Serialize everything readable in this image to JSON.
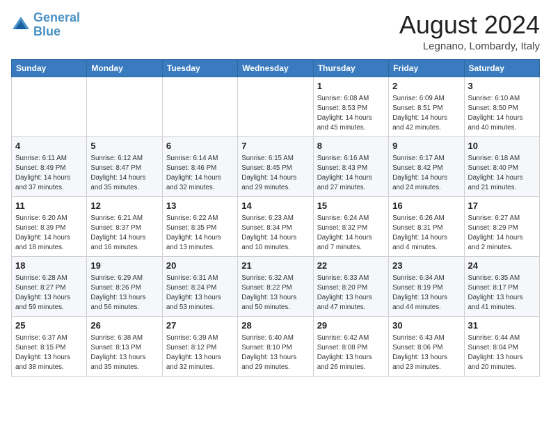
{
  "header": {
    "logo_line1": "General",
    "logo_line2": "Blue",
    "month_title": "August 2024",
    "location": "Legnano, Lombardy, Italy"
  },
  "weekdays": [
    "Sunday",
    "Monday",
    "Tuesday",
    "Wednesday",
    "Thursday",
    "Friday",
    "Saturday"
  ],
  "weeks": [
    [
      {
        "day": "",
        "info": ""
      },
      {
        "day": "",
        "info": ""
      },
      {
        "day": "",
        "info": ""
      },
      {
        "day": "",
        "info": ""
      },
      {
        "day": "1",
        "info": "Sunrise: 6:08 AM\nSunset: 8:53 PM\nDaylight: 14 hours\nand 45 minutes."
      },
      {
        "day": "2",
        "info": "Sunrise: 6:09 AM\nSunset: 8:51 PM\nDaylight: 14 hours\nand 42 minutes."
      },
      {
        "day": "3",
        "info": "Sunrise: 6:10 AM\nSunset: 8:50 PM\nDaylight: 14 hours\nand 40 minutes."
      }
    ],
    [
      {
        "day": "4",
        "info": "Sunrise: 6:11 AM\nSunset: 8:49 PM\nDaylight: 14 hours\nand 37 minutes."
      },
      {
        "day": "5",
        "info": "Sunrise: 6:12 AM\nSunset: 8:47 PM\nDaylight: 14 hours\nand 35 minutes."
      },
      {
        "day": "6",
        "info": "Sunrise: 6:14 AM\nSunset: 8:46 PM\nDaylight: 14 hours\nand 32 minutes."
      },
      {
        "day": "7",
        "info": "Sunrise: 6:15 AM\nSunset: 8:45 PM\nDaylight: 14 hours\nand 29 minutes."
      },
      {
        "day": "8",
        "info": "Sunrise: 6:16 AM\nSunset: 8:43 PM\nDaylight: 14 hours\nand 27 minutes."
      },
      {
        "day": "9",
        "info": "Sunrise: 6:17 AM\nSunset: 8:42 PM\nDaylight: 14 hours\nand 24 minutes."
      },
      {
        "day": "10",
        "info": "Sunrise: 6:18 AM\nSunset: 8:40 PM\nDaylight: 14 hours\nand 21 minutes."
      }
    ],
    [
      {
        "day": "11",
        "info": "Sunrise: 6:20 AM\nSunset: 8:39 PM\nDaylight: 14 hours\nand 18 minutes."
      },
      {
        "day": "12",
        "info": "Sunrise: 6:21 AM\nSunset: 8:37 PM\nDaylight: 14 hours\nand 16 minutes."
      },
      {
        "day": "13",
        "info": "Sunrise: 6:22 AM\nSunset: 8:35 PM\nDaylight: 14 hours\nand 13 minutes."
      },
      {
        "day": "14",
        "info": "Sunrise: 6:23 AM\nSunset: 8:34 PM\nDaylight: 14 hours\nand 10 minutes."
      },
      {
        "day": "15",
        "info": "Sunrise: 6:24 AM\nSunset: 8:32 PM\nDaylight: 14 hours\nand 7 minutes."
      },
      {
        "day": "16",
        "info": "Sunrise: 6:26 AM\nSunset: 8:31 PM\nDaylight: 14 hours\nand 4 minutes."
      },
      {
        "day": "17",
        "info": "Sunrise: 6:27 AM\nSunset: 8:29 PM\nDaylight: 14 hours\nand 2 minutes."
      }
    ],
    [
      {
        "day": "18",
        "info": "Sunrise: 6:28 AM\nSunset: 8:27 PM\nDaylight: 13 hours\nand 59 minutes."
      },
      {
        "day": "19",
        "info": "Sunrise: 6:29 AM\nSunset: 8:26 PM\nDaylight: 13 hours\nand 56 minutes."
      },
      {
        "day": "20",
        "info": "Sunrise: 6:31 AM\nSunset: 8:24 PM\nDaylight: 13 hours\nand 53 minutes."
      },
      {
        "day": "21",
        "info": "Sunrise: 6:32 AM\nSunset: 8:22 PM\nDaylight: 13 hours\nand 50 minutes."
      },
      {
        "day": "22",
        "info": "Sunrise: 6:33 AM\nSunset: 8:20 PM\nDaylight: 13 hours\nand 47 minutes."
      },
      {
        "day": "23",
        "info": "Sunrise: 6:34 AM\nSunset: 8:19 PM\nDaylight: 13 hours\nand 44 minutes."
      },
      {
        "day": "24",
        "info": "Sunrise: 6:35 AM\nSunset: 8:17 PM\nDaylight: 13 hours\nand 41 minutes."
      }
    ],
    [
      {
        "day": "25",
        "info": "Sunrise: 6:37 AM\nSunset: 8:15 PM\nDaylight: 13 hours\nand 38 minutes."
      },
      {
        "day": "26",
        "info": "Sunrise: 6:38 AM\nSunset: 8:13 PM\nDaylight: 13 hours\nand 35 minutes."
      },
      {
        "day": "27",
        "info": "Sunrise: 6:39 AM\nSunset: 8:12 PM\nDaylight: 13 hours\nand 32 minutes."
      },
      {
        "day": "28",
        "info": "Sunrise: 6:40 AM\nSunset: 8:10 PM\nDaylight: 13 hours\nand 29 minutes."
      },
      {
        "day": "29",
        "info": "Sunrise: 6:42 AM\nSunset: 8:08 PM\nDaylight: 13 hours\nand 26 minutes."
      },
      {
        "day": "30",
        "info": "Sunrise: 6:43 AM\nSunset: 8:06 PM\nDaylight: 13 hours\nand 23 minutes."
      },
      {
        "day": "31",
        "info": "Sunrise: 6:44 AM\nSunset: 8:04 PM\nDaylight: 13 hours\nand 20 minutes."
      }
    ]
  ]
}
